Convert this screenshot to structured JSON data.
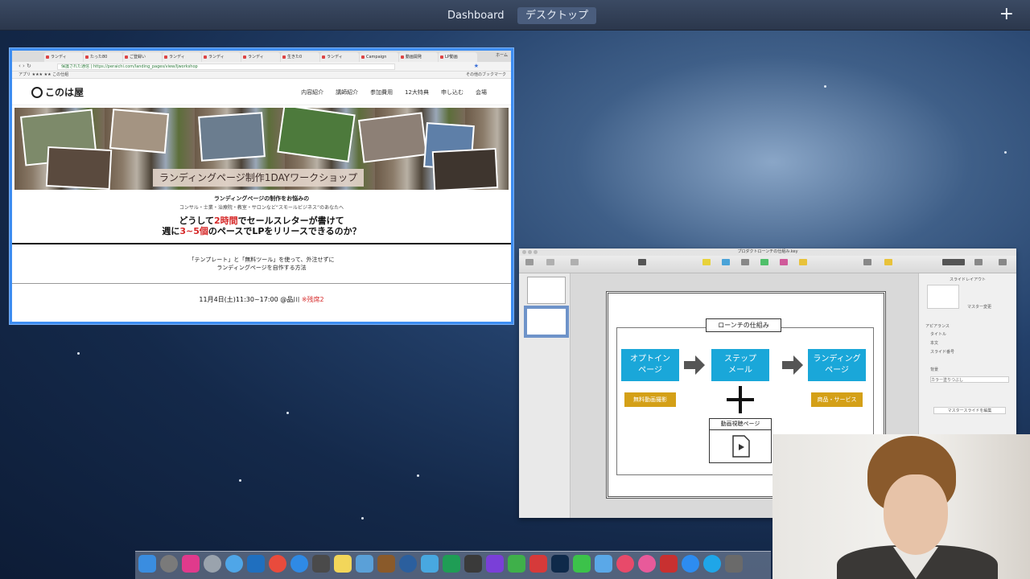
{
  "mission_control": {
    "dashboard_label": "Dashboard",
    "desktop_label": "デスクトップ",
    "add_space_label": "+"
  },
  "browser": {
    "tabs": [
      "ランディ",
      "たった80",
      "ご登録い",
      "ランディ",
      "ランディ",
      "ランディ",
      "生きた0",
      "ランディ",
      "Campaign",
      "動画開発",
      "LP動画"
    ],
    "tab_overflow": "ホーム",
    "url": "保護された通信 | https://peraichi.com/landing_pages/view/ljworkshop",
    "bookmarks_left": "アプリ  ★★★  ★★  この仕組",
    "bookmarks_right": "その他のブックマーク"
  },
  "site": {
    "logo_text": "このは屋",
    "nav": [
      "内容紹介",
      "講師紹介",
      "参加費用",
      "12大特典",
      "申し込む",
      "会場"
    ],
    "hero_label": "ランディングページ制作1DAYワークショップ",
    "intro_line1": "ランディングページの制作をお悩みの",
    "intro_line2": "コンサル・士業・治療院・教室・サロンなど“スモールビジネス”のあなたへ",
    "headline1_a": "どうして",
    "headline1_red": "2時間",
    "headline1_b": "でセールスレターが書けて",
    "headline2_a": "週に",
    "headline2_red": "3~5個",
    "headline2_b": "のペースでLPをリリースできるのか？",
    "sub_line1": "「テンプレート」と「無料ツール」を使って、外注せずに",
    "sub_line2": "ランディングページを自作する方法",
    "date_text": "11月4日(土)11:30~17:00 @品川",
    "date_remaining": "※残席2"
  },
  "keynote": {
    "title": "プロダクトローンチの仕組み.key",
    "inspector_title": "スライドレイアウト",
    "inspector_master": "マスター変更",
    "inspector_appearance": "アピアランス",
    "inspector_options": [
      "タイトル",
      "本文",
      "スライド番号"
    ],
    "inspector_background": "背景",
    "inspector_bg_value": "カラー塗りつぶし",
    "inspector_edit_master": "マスタースライドを編集"
  },
  "diagram": {
    "title": "ローンチの仕組み",
    "box1": "オプトイン\nページ",
    "box2": "ステップ\nメール",
    "box3": "ランディング\nページ",
    "tag_left": "無料動画撮影",
    "tag_right": "商品・サービス",
    "video_page_label": "動画視聴ページ"
  },
  "dock": {
    "icons": [
      "finder-icon",
      "system-preferences-icon",
      "affinity-icon",
      "launchpad-icon",
      "cyberduck-icon",
      "trello-icon",
      "chrome-icon",
      "safari-icon",
      "calculator-icon",
      "notes-icon",
      "automator-icon",
      "cleaner-icon",
      "finder-search-icon",
      "bird-icon",
      "sheets-icon",
      "final-cut-icon",
      "imovie-icon",
      "evernote-icon",
      "xmind-icon",
      "photoshop-icon",
      "line-icon",
      "pen-icon",
      "app-store-icon",
      "music-icon",
      "filezilla-icon",
      "zoom-icon",
      "skype-icon",
      "stacks-icon"
    ]
  },
  "colors": {
    "accent_blue": "#1aa7d9",
    "tag_gold": "#d4a017",
    "headline_red": "#d62a2a",
    "window_highlight": "#3d8df1"
  }
}
